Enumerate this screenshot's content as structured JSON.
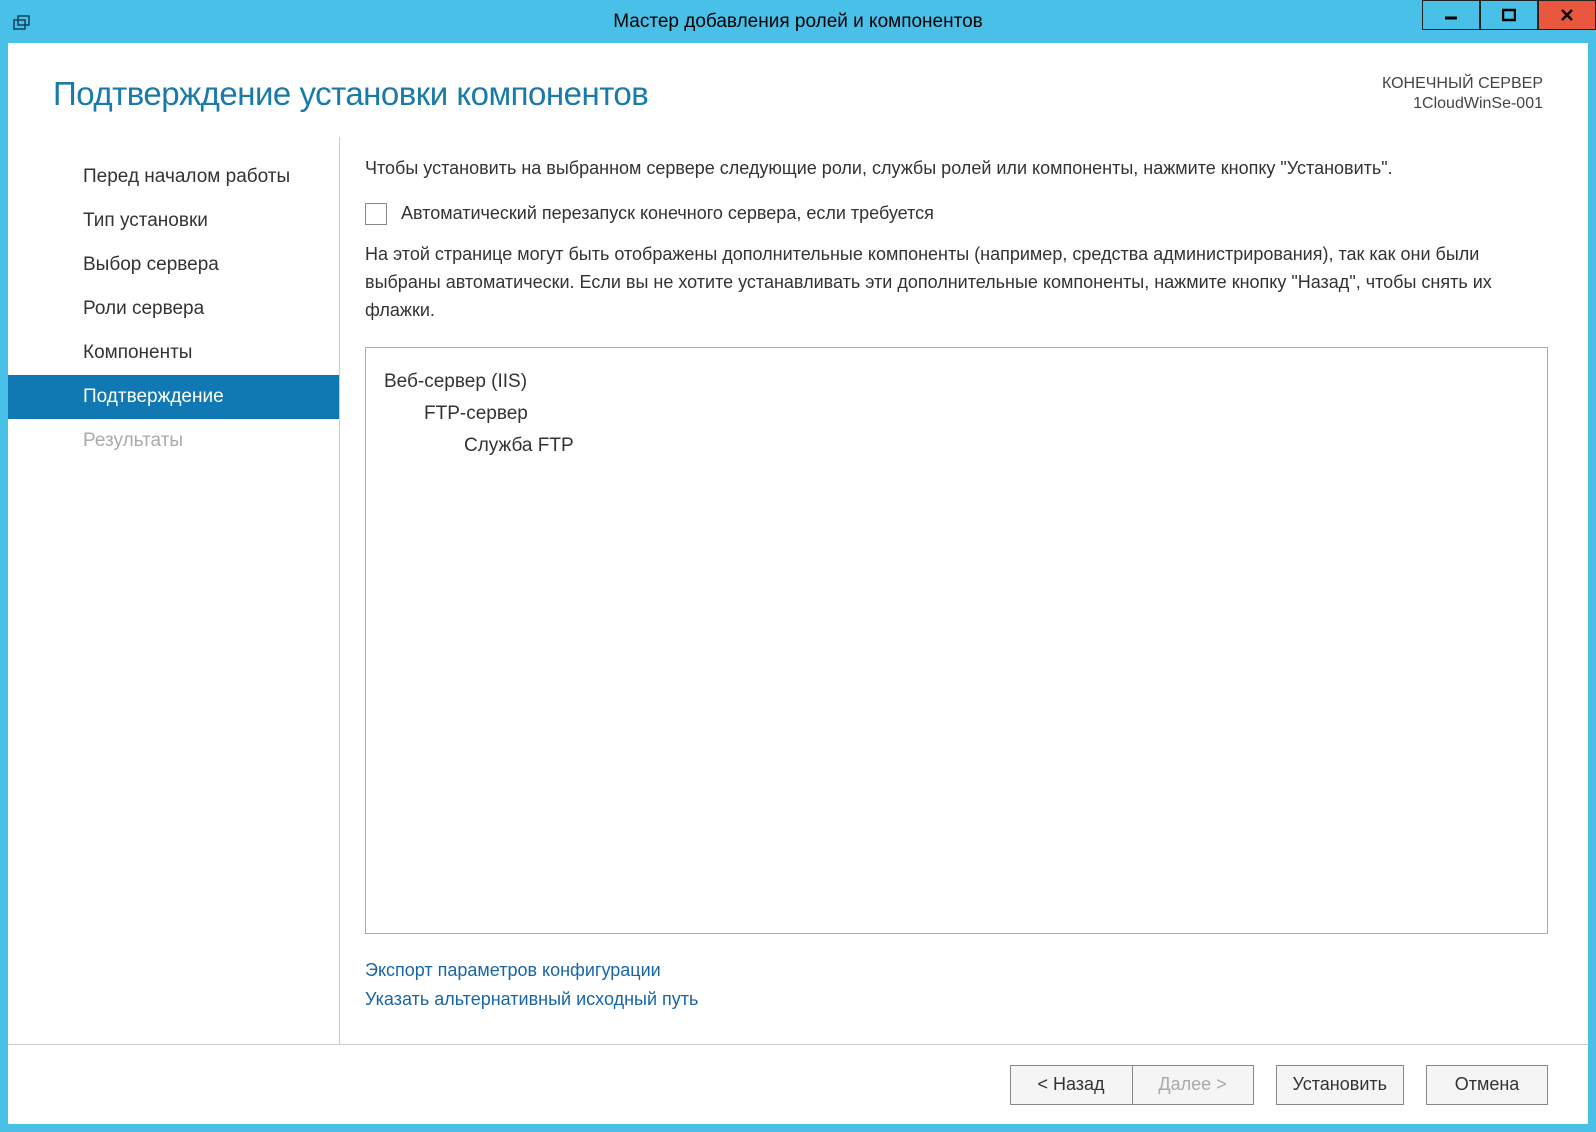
{
  "titlebar": {
    "title": "Мастер добавления ролей и компонентов"
  },
  "header": {
    "page_title": "Подтверждение установки компонентов",
    "server_label": "КОНЕЧНЫЙ СЕРВЕР",
    "server_name": "1CloudWinSe-001"
  },
  "sidebar": {
    "items": [
      {
        "label": "Перед началом работы",
        "state": "normal"
      },
      {
        "label": "Тип установки",
        "state": "normal"
      },
      {
        "label": "Выбор сервера",
        "state": "normal"
      },
      {
        "label": "Роли сервера",
        "state": "normal"
      },
      {
        "label": "Компоненты",
        "state": "normal"
      },
      {
        "label": "Подтверждение",
        "state": "active"
      },
      {
        "label": "Результаты",
        "state": "disabled"
      }
    ]
  },
  "main": {
    "instruction": "Чтобы установить на выбранном сервере следующие роли, службы ролей или компоненты, нажмите кнопку \"Установить\".",
    "checkbox_label": "Автоматический перезапуск конечного сервера, если требуется",
    "checkbox_checked": false,
    "info": "На этой странице могут быть отображены дополнительные компоненты (например, средства администрирования), так как они были выбраны автоматически. Если вы не хотите устанавливать эти дополнительные компоненты, нажмите кнопку \"Назад\", чтобы снять их флажки.",
    "tree": [
      {
        "label": "Веб-сервер (IIS)",
        "level": 0
      },
      {
        "label": "FTP-сервер",
        "level": 1
      },
      {
        "label": "Служба FTP",
        "level": 2
      }
    ],
    "links": {
      "export": "Экспорт параметров конфигурации",
      "alt_path": "Указать альтернативный исходный путь"
    }
  },
  "footer": {
    "back": "< Назад",
    "next": "Далее >",
    "install": "Установить",
    "cancel": "Отмена"
  }
}
